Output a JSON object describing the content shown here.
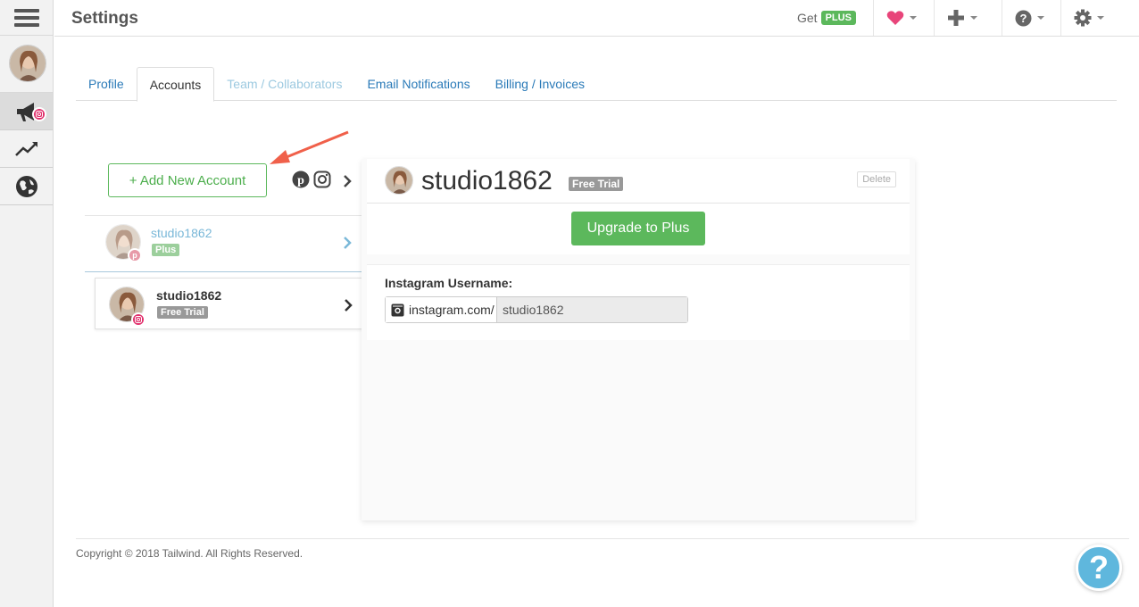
{
  "header": {
    "title": "Settings",
    "get_label": "Get",
    "plus_badge": "PLUS"
  },
  "tabs": [
    {
      "label": "Profile",
      "state": "link"
    },
    {
      "label": "Accounts",
      "state": "active"
    },
    {
      "label": "Team / Collaborators",
      "state": "disabled"
    },
    {
      "label": "Email Notifications",
      "state": "link"
    },
    {
      "label": "Billing / Invoices",
      "state": "link"
    }
  ],
  "accounts": {
    "add_button": "+ Add New Account",
    "items": [
      {
        "name": "studio1862",
        "badge": "Plus",
        "network": "pinterest"
      },
      {
        "name": "studio1862",
        "badge": "Free Trial",
        "network": "instagram"
      }
    ]
  },
  "panel": {
    "title": "studio1862",
    "badge": "Free Trial",
    "delete_label": "Delete",
    "upgrade_label": "Upgrade to Plus",
    "username_label": "Instagram Username:",
    "prefix": "instagram.com/",
    "username_value": "studio1862"
  },
  "footer": {
    "copyright": "Copyright © 2018 Tailwind. All Rights Reserved."
  },
  "help": {
    "label": "?"
  },
  "colors": {
    "accent_green": "#5cb85c",
    "link_blue": "#2a7ab8",
    "heart_pink": "#e8457a",
    "help_blue": "#5fb7dd"
  }
}
